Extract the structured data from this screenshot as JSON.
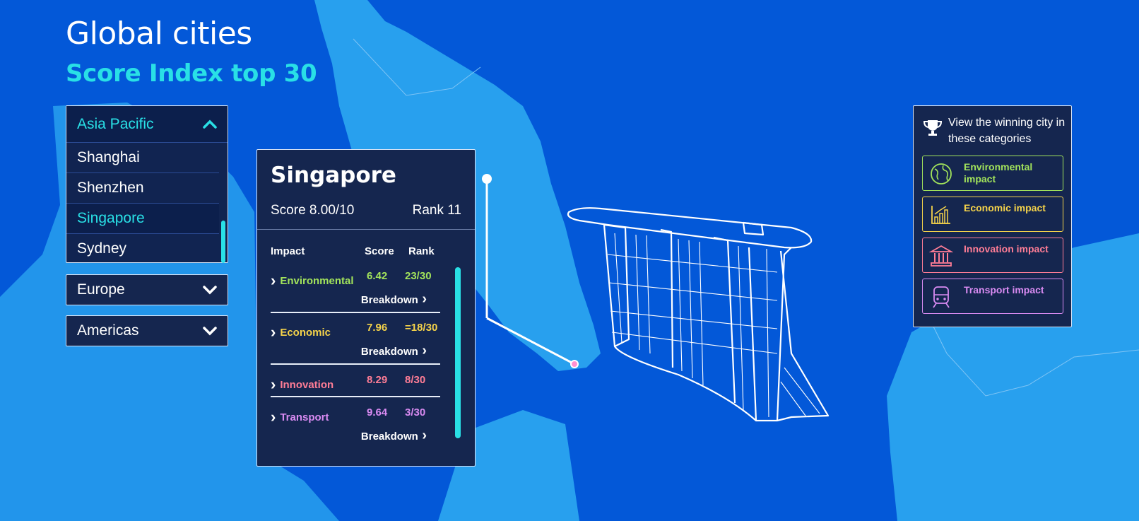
{
  "header": {
    "title": "Global cities",
    "subtitle": "Score Index top 30"
  },
  "regions": {
    "open": {
      "label": "Asia Pacific",
      "cities": [
        "Shanghai",
        "Shenzhen",
        "Singapore",
        "Sydney"
      ],
      "selected": "Singapore"
    },
    "europe": {
      "label": "Europe"
    },
    "americas": {
      "label": "Americas"
    }
  },
  "card": {
    "city": "Singapore",
    "score": "Score 8.00/10",
    "rank": "Rank 11",
    "headers": {
      "impact": "Impact",
      "score": "Score",
      "rank": "Rank"
    },
    "impacts": [
      {
        "name": "Environmental",
        "score": "6.42",
        "rank": "23/30",
        "breakdown": "Breakdown",
        "color": "#a2e35b"
      },
      {
        "name": "Economic",
        "score": "7.96",
        "rank": "=18/30",
        "breakdown": "Breakdown",
        "color": "#f5d34a"
      },
      {
        "name": "Innovation",
        "score": "8.29",
        "rank": "8/30",
        "color": "#ff7d96"
      },
      {
        "name": "Transport",
        "score": "9.64",
        "rank": "3/30",
        "breakdown": "Breakdown",
        "color": "#d98bf2"
      }
    ]
  },
  "categories": {
    "heading": "View the winning city in these categories",
    "items": [
      {
        "label": "Environmental impact",
        "icon": "globe-icon",
        "color": "#a2e35b"
      },
      {
        "label": "Economic impact",
        "icon": "bar-chart-icon",
        "color": "#f5d34a"
      },
      {
        "label": "Innovation impact",
        "icon": "institution-icon",
        "color": "#ff7d96"
      },
      {
        "label": "Transport impact",
        "icon": "train-icon",
        "color": "#d98bf2"
      }
    ]
  },
  "colors": {
    "background": "#0358d8",
    "land": "#28a0ee",
    "panel": "#15264f",
    "accent": "#29e0e6"
  }
}
